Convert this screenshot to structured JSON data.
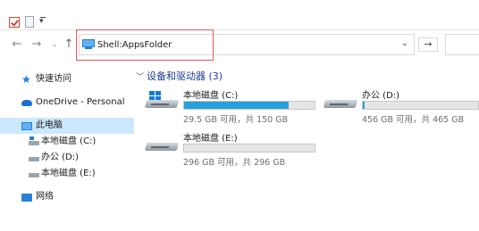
{
  "window": {
    "qat_dropdown": "▾"
  },
  "nav": {
    "back": "←",
    "forward": "→",
    "recent": "⌄",
    "up": "↑",
    "address_value": "Shell:AppsFolder",
    "address_dropdown": "⌄",
    "go": "→"
  },
  "sidebar": {
    "items": [
      {
        "label": "快速访问",
        "icon": "star-icon"
      },
      {
        "label": "OneDrive - Personal",
        "icon": "cloud-icon"
      },
      {
        "label": "此电脑",
        "icon": "computer-icon",
        "selected": true
      },
      {
        "label": "本地磁盘 (C:)",
        "icon": "windows-drive-icon"
      },
      {
        "label": "办公 (D:)",
        "icon": "drive-icon"
      },
      {
        "label": "本地磁盘 (E:)",
        "icon": "drive-icon"
      },
      {
        "label": "网络",
        "icon": "network-icon"
      }
    ]
  },
  "main": {
    "group_header": "设备和驱动器 (3)",
    "group_chevron": "﹀",
    "drives": [
      {
        "name": "本地磁盘 (C:)",
        "info": "29.5 GB 可用，共 150 GB",
        "used_fraction": 0.803
      },
      {
        "name": "办公 (D:)",
        "info": "456 GB 可用，共 465 GB",
        "used_fraction": 0.019
      },
      {
        "name": "本地磁盘 (E:)",
        "info": "296 GB 可用，共 296 GB",
        "used_fraction": 0.0
      }
    ]
  },
  "colors": {
    "accent": "#26a0da",
    "selection": "#cce8ff",
    "highlight_box": "#e05a5a"
  }
}
